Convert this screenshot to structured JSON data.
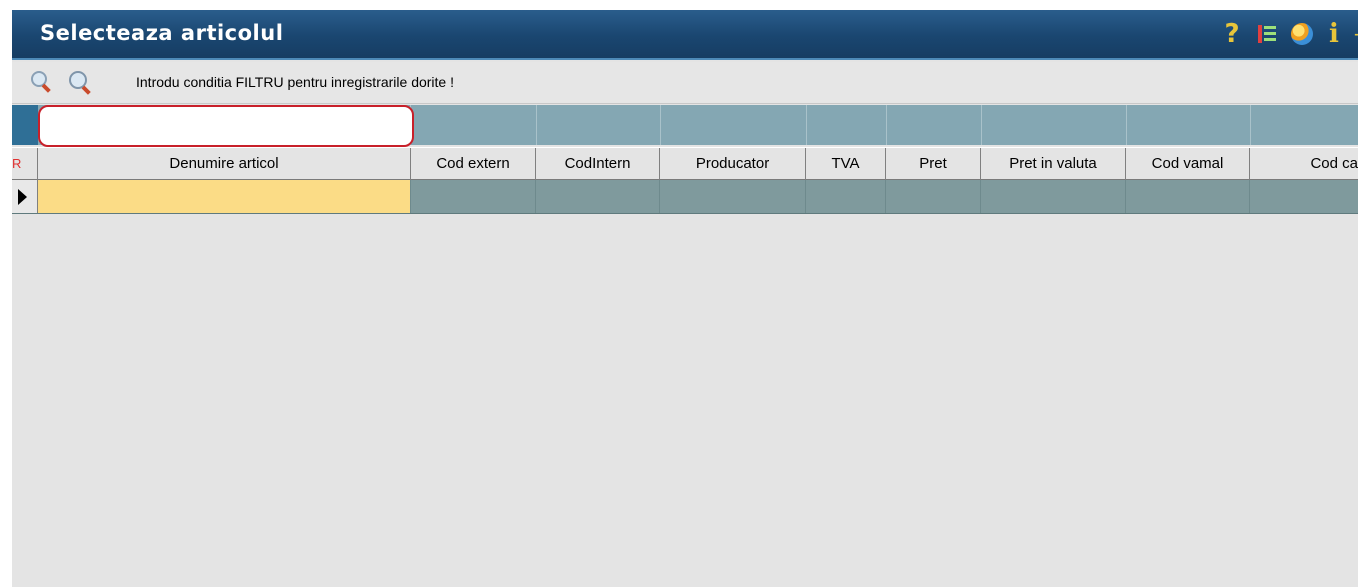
{
  "window": {
    "title": "Selecteaza articolul",
    "title_icons": [
      "help-icon",
      "tree-list-icon",
      "globe-icon",
      "info-icon",
      "more-icon"
    ],
    "icon_help_glyph": "?",
    "icon_info_glyph": "i",
    "icon_more_glyph": "-"
  },
  "toolbar": {
    "search_icon": "search-icon",
    "advanced_search_icon": "search-advanced-icon",
    "hint": "Introdu conditia FILTRU pentru inregistrarile dorite !"
  },
  "filter": {
    "value": "",
    "highlight_color": "#c8202a"
  },
  "grid": {
    "row_marker_label": "R",
    "columns": [
      "Denumire articol",
      "Cod extern",
      "CodIntern",
      "Producator",
      "TVA",
      "Pret",
      "Pret in valuta",
      "Cod vamal",
      "Cod ca"
    ],
    "rows": [
      [
        "",
        "",
        "",
        "",
        "",
        "",
        "",
        "",
        ""
      ]
    ],
    "selected_cell_color": "#fbdc86",
    "row_color": "#7f9a9d"
  },
  "colors": {
    "titlebar": "#1a4670",
    "filter_row": "#84a7b3",
    "background": "#e4e4e4"
  }
}
